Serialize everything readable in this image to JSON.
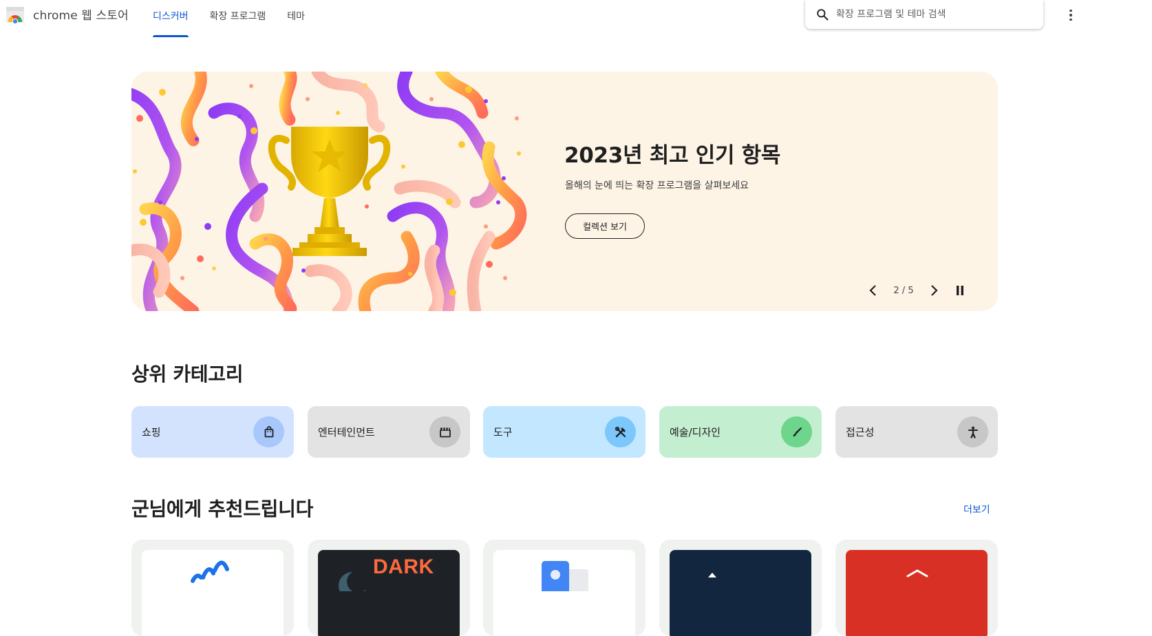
{
  "header": {
    "logo_text": "chrome 웹 스토어",
    "tabs": [
      {
        "label": "디스커버",
        "active": true
      },
      {
        "label": "확장 프로그램",
        "active": false
      },
      {
        "label": "테마",
        "active": false
      }
    ],
    "search_placeholder": "확장 프로그램 및 테마 검색"
  },
  "hero": {
    "title": "2023년 최고 인기 항목",
    "subtitle": "올해의 눈에 띄는 확장 프로그램을 살펴보세요",
    "button_label": "컬렉션 보기",
    "counter": "2 / 5",
    "background_color": "#fdf4e6"
  },
  "categories": {
    "title": "상위 카테고리",
    "items": [
      {
        "label": "쇼핑",
        "icon": "shopping-bag-icon",
        "bg": "#d3e3fd",
        "icon_bg": "#a8c7fa"
      },
      {
        "label": "엔터테인먼트",
        "icon": "clapperboard-icon",
        "bg": "#e3e3e3",
        "icon_bg": "#c7c7c7"
      },
      {
        "label": "도구",
        "icon": "tools-icon",
        "bg": "#c2e7ff",
        "icon_bg": "#7cc7fb"
      },
      {
        "label": "예술/디자인",
        "icon": "brush-icon",
        "bg": "#c4eed0",
        "icon_bg": "#6dd58c"
      },
      {
        "label": "접근성",
        "icon": "accessibility-icon",
        "bg": "#e3e3e3",
        "icon_bg": "#c7c7c7"
      }
    ]
  },
  "recommended": {
    "title": "군님에게 추천드립니다",
    "more_label": "더보기",
    "cards": [
      {
        "thumb_text": "",
        "thumb_bg": "#ffffff",
        "icon": "signal-waves-icon"
      },
      {
        "thumb_text": "DARK",
        "thumb_bg": "#1e2227",
        "icon": "dark-mode-icon"
      },
      {
        "thumb_text": "",
        "thumb_bg": "#ffffff",
        "icon": "document-icon"
      },
      {
        "thumb_text": "",
        "thumb_bg": "#13263f",
        "icon": "dark-thumb-icon"
      },
      {
        "thumb_text": "",
        "thumb_bg": "#d93025",
        "icon": "red-thumb-icon"
      }
    ]
  },
  "accent_color": "#0b57d0"
}
